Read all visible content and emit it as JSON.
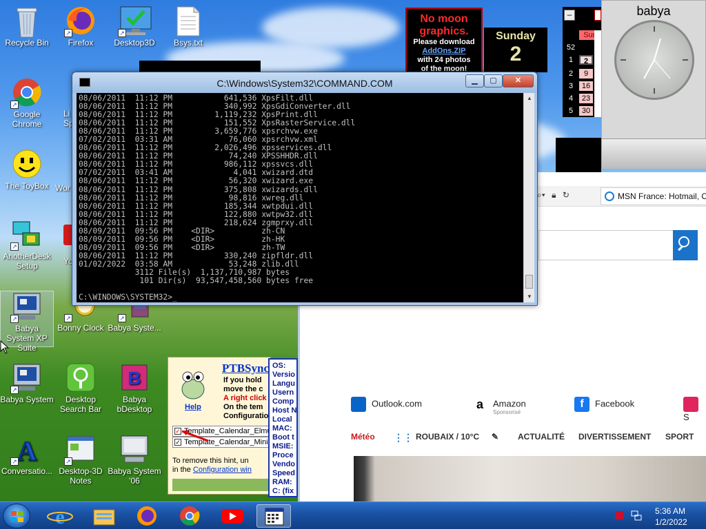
{
  "desktop": {
    "icons": [
      {
        "label": "Recycle Bin"
      },
      {
        "label": "Firefox"
      },
      {
        "label": "Desktop3D"
      },
      {
        "label": "Bsys.txt"
      },
      {
        "label": "Google Chrome"
      },
      {
        "label": "The ToyBox"
      },
      {
        "label": "AnotherDesk Setup"
      },
      {
        "label": "Babya System XP Suite"
      },
      {
        "label": "Bonny Clock"
      },
      {
        "label": "Babya Syste..."
      },
      {
        "label": "Babya System"
      },
      {
        "label": "Desktop Search Bar"
      },
      {
        "label": "Babya bDesktop"
      },
      {
        "label": "Conversatio..."
      },
      {
        "label": "Desktop-3D Notes"
      },
      {
        "label": "Babya System '06"
      }
    ],
    "partial_labels": {
      "li": "Li",
      "spa": "Spa",
      "wor": "Wor",
      "yo": "Yo"
    }
  },
  "cmd": {
    "title": "C:\\Windows\\System32\\COMMAND.COM",
    "min": "▁",
    "max": "▢",
    "close": "✕",
    "up": "▲",
    "down": "▼",
    "lines": [
      "08/06/2011  11:12 PM           641,536 XpsFilt.dll",
      "08/06/2011  11:12 PM           340,992 XpsGdiConverter.dll",
      "08/06/2011  11:12 PM         1,119,232 XpsPrint.dll",
      "08/06/2011  11:12 PM           151,552 XpsRasterService.dll",
      "08/06/2011  11:12 PM         3,659,776 xpsrchvw.exe",
      "07/02/2011  03:31 AM            76,060 xpsrchvw.xml",
      "08/06/2011  11:12 PM         2,026,496 xpsservices.dll",
      "08/06/2011  11:12 PM            74,240 XPSSHHDR.dll",
      "08/06/2011  11:12 PM           986,112 xpssvcs.dll",
      "07/02/2011  03:41 AM             4,041 xwizard.dtd",
      "08/06/2011  11:12 PM            56,320 xwizard.exe",
      "08/06/2011  11:12 PM           375,808 xwizards.dll",
      "08/06/2011  11:12 PM            98,816 xwreg.dll",
      "08/06/2011  11:12 PM           185,344 xwtpdui.dll",
      "08/06/2011  11:12 PM           122,880 xwtpw32.dll",
      "08/06/2011  11:12 PM           218,624 zgmprxy.dll",
      "08/09/2011  09:56 PM    <DIR>          zh-CN",
      "08/09/2011  09:56 PM    <DIR>          zh-HK",
      "08/09/2011  09:56 PM    <DIR>          zh-TW",
      "08/06/2011  11:12 PM           330,240 zipfldr.dll",
      "01/02/2022  03:58 AM            53,248 zlib.dll",
      "            3112 File(s)  1,137,710,987 bytes",
      "             101 Dir(s)  93,547,458,560 bytes free",
      "",
      "C:\\WINDOWS\\SYSTEM32>_"
    ]
  },
  "browser": {
    "tab_title": "MSN France: Hotmail, Outlook",
    "quick_links": [
      {
        "label": "Outlook.com",
        "sub": ""
      },
      {
        "label": "Amazon",
        "sub": "Sponsorisé"
      },
      {
        "label": "Facebook",
        "sub": ""
      },
      {
        "label": "S",
        "sub": ""
      }
    ],
    "nav": {
      "meteo": "Météo",
      "weather": "ROUBAIX / 10°C",
      "items": [
        "ACTUALITÉ",
        "DIVERTISSEMENT",
        "SPORT"
      ]
    }
  },
  "moon_widget": {
    "title": "No moon graphics.",
    "line1": "Please download",
    "link": "AddOns.ZIP",
    "line2": "with 24 photos",
    "line3": "of the moon!"
  },
  "day_widget": {
    "day": "Sunday",
    "date": "2"
  },
  "calendar_widget": {
    "header": "Sun",
    "weeks": [
      "52",
      "1",
      "2",
      "3",
      "4",
      "5"
    ],
    "days": [
      "2",
      "9",
      "16",
      "23",
      "30"
    ]
  },
  "clock_widget": {
    "name": "babya"
  },
  "ptb": {
    "title": "PTBSync",
    "lines": [
      "If you hold",
      "move the c",
      "A right click",
      "On the tem",
      "Configuratio"
    ],
    "help": "Help",
    "items": [
      "Template_Calendar_Elmue",
      "Template_Calendar_Mini"
    ],
    "hint1": "To remove this hint, un",
    "hint2": "in the",
    "hint_link": "Configuration win"
  },
  "sysinfo": {
    "lines": [
      "OS:",
      "Versio",
      "Langu",
      "Usern",
      "Comp",
      "Host N",
      "Local",
      "MAC:",
      "Boot t",
      "MSIE:",
      "Proce",
      "Vendo",
      "Speed",
      "RAM:",
      "C: (fix"
    ]
  },
  "taskbar": {
    "time": "5:36 AM",
    "date": "1/2/2022"
  }
}
